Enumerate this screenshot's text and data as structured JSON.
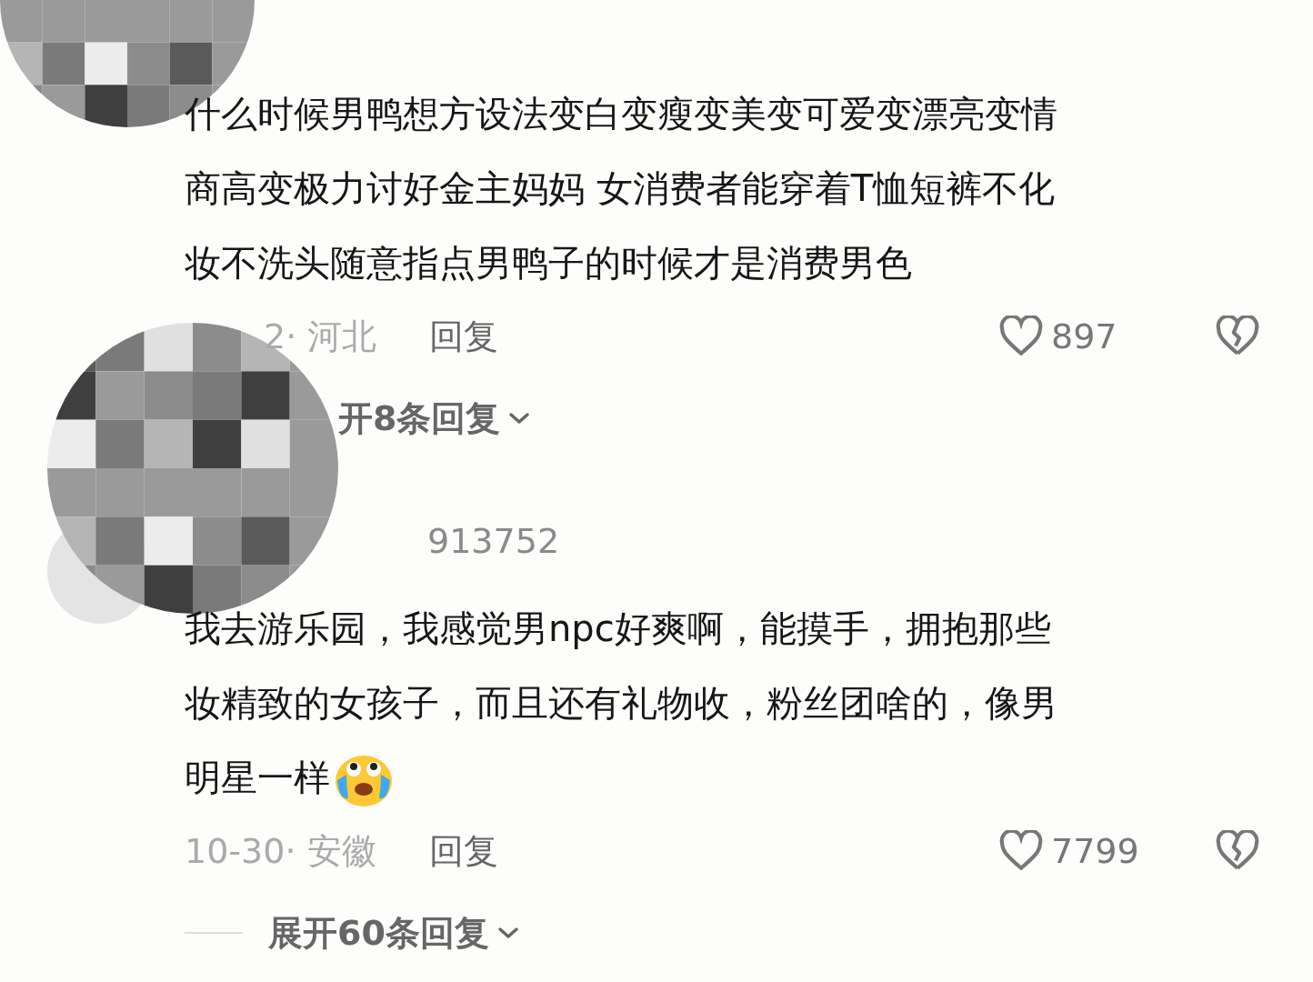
{
  "comments": [
    {
      "text_lines": [
        "什么时候男鸭想方设法变白变瘦变美变可爱变漂亮变情",
        "商高变极力讨好金主妈妈 女消费者能穿着T恤短裤不化",
        "妆不洗头随意指点男鸭子的时候才是消费男色"
      ],
      "meta": "2· 河北",
      "reply": "回复",
      "likes": "897",
      "expand": "开8条回复"
    },
    {
      "username": "913752",
      "text_lines": [
        "我去游乐园，我感觉男npc好爽啊，能摸手，拥抱那些",
        "妆精致的女孩子，而且还有礼物收，粉丝团啥的，像男",
        "明星一样"
      ],
      "emoji": true,
      "meta": "10-30· 安徽",
      "reply": "回复",
      "likes": "7799",
      "expand": "展开60条回复",
      "expand_rule": true
    }
  ]
}
